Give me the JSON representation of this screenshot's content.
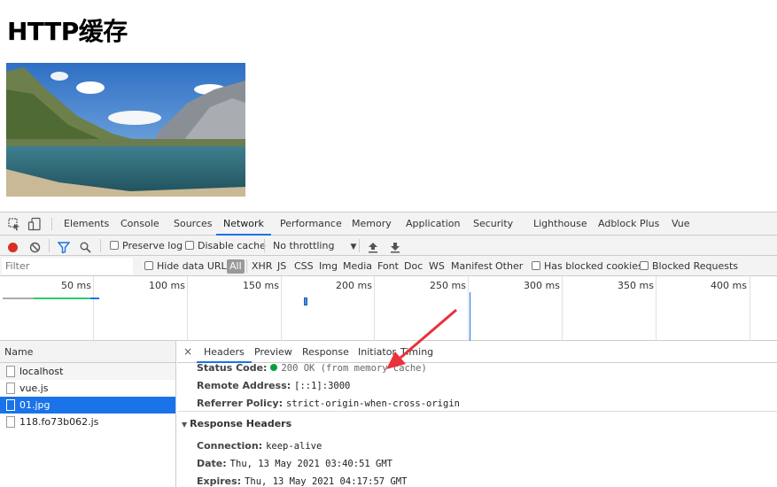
{
  "page": {
    "title": "HTTP缓存"
  },
  "devtools": {
    "tabs": [
      "Elements",
      "Console",
      "Sources",
      "Network",
      "Performance",
      "Memory",
      "Application",
      "Security",
      "Lighthouse",
      "Adblock Plus",
      "Vue"
    ],
    "active_tab": "Network",
    "toolbar": {
      "preserve_log": "Preserve log",
      "disable_cache": "Disable cache",
      "throttling": "No throttling"
    },
    "filter": {
      "placeholder": "Filter",
      "hide_data_urls": "Hide data URLs",
      "types": [
        "All",
        "XHR",
        "JS",
        "CSS",
        "Img",
        "Media",
        "Font",
        "Doc",
        "WS",
        "Manifest",
        "Other"
      ],
      "has_blocked_cookies": "Has blocked cookies",
      "blocked_requests": "Blocked Requests"
    },
    "timeline": {
      "labels": [
        "50 ms",
        "100 ms",
        "150 ms",
        "200 ms",
        "250 ms",
        "300 ms",
        "350 ms",
        "400 ms"
      ]
    },
    "requests": {
      "header": "Name",
      "rows": [
        "localhost",
        "vue.js",
        "01.jpg",
        "118.fo73b062.js"
      ],
      "selected": "01.jpg"
    },
    "detail": {
      "close": "×",
      "tabs": [
        "Headers",
        "Preview",
        "Response",
        "Initiator",
        "Timing"
      ],
      "active_tab": "Headers",
      "general": {
        "status_code_label": "Status Code:",
        "status_code_value": "200 OK (from memory cache)",
        "remote_address_label": "Remote Address:",
        "remote_address_value": "[::1]:3000",
        "referrer_policy_label": "Referrer Policy:",
        "referrer_policy_value": "strict-origin-when-cross-origin"
      },
      "response_headers_title": "Response Headers",
      "response_headers": {
        "connection_label": "Connection:",
        "connection_value": "keep-alive",
        "date_label": "Date:",
        "date_value": "Thu, 13 May 2021 03:40:51 GMT",
        "expires_label": "Expires:",
        "expires_value": "Thu, 13 May 2021 04:17:57 GMT"
      }
    }
  },
  "colors": {
    "accent": "#1a73e8",
    "record": "#d93025",
    "status_ok": "#0a9e3c",
    "annotation_arrow": "#e8323c"
  },
  "icons": [
    "inspect-icon",
    "device-toggle-icon",
    "record-icon",
    "clear-icon",
    "filter-icon",
    "search-icon",
    "upload-icon",
    "download-icon",
    "file-icon",
    "triangle-icon",
    "annotation-arrow"
  ]
}
